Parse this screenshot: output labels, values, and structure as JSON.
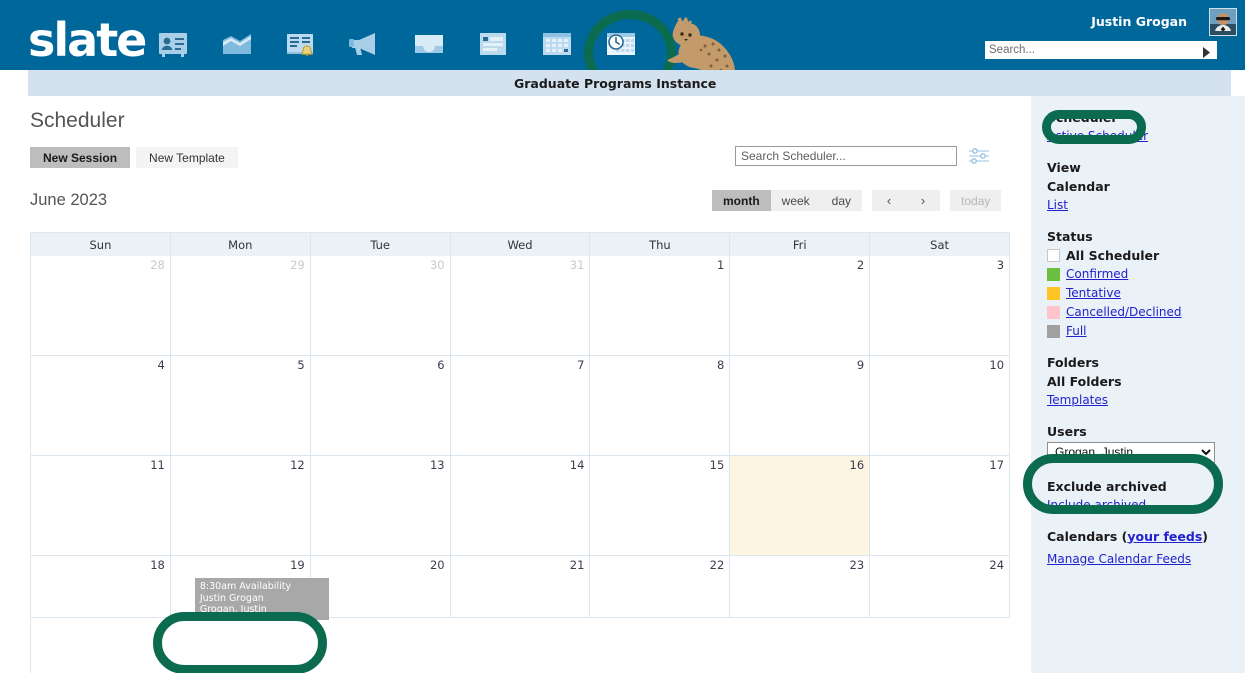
{
  "header": {
    "logo_text": "slate",
    "instance_title": "Graduate Programs Instance",
    "username": "Justin Grogan",
    "search_placeholder": "Search...",
    "search_value": "",
    "nav_icons": [
      {
        "name": "contact-card-icon",
        "label": "Records"
      },
      {
        "name": "analytics-chart-icon",
        "label": "Analytics"
      },
      {
        "name": "document-bell-icon",
        "label": "Reader"
      },
      {
        "name": "megaphone-icon",
        "label": "Deliver"
      },
      {
        "name": "inbox-tray-icon",
        "label": "Inbox"
      },
      {
        "name": "forms-list-icon",
        "label": "Forms"
      },
      {
        "name": "calendar-grid-icon",
        "label": "Calendar"
      },
      {
        "name": "scheduler-clock-calendar-icon",
        "label": "Scheduler"
      }
    ],
    "active_nav_index": 7
  },
  "toolbar": {
    "page_title": "Scheduler",
    "new_session_label": "New Session",
    "new_template_label": "New Template",
    "scheduler_search_placeholder": "Search Scheduler...",
    "scheduler_search_value": "",
    "filter_icon": "filter-sliders-icon"
  },
  "calendar": {
    "month_label": "June 2023",
    "views": [
      "month",
      "week",
      "day"
    ],
    "active_view": "month",
    "prev_label": "‹",
    "next_label": "›",
    "today_label": "today",
    "today_enabled": false,
    "weekdays": [
      "Sun",
      "Mon",
      "Tue",
      "Wed",
      "Thu",
      "Fri",
      "Sat"
    ],
    "today_date": 16,
    "today_bg": "#FCF5E2",
    "weeks": [
      [
        {
          "day": "28",
          "other": true
        },
        {
          "day": "29",
          "other": true
        },
        {
          "day": "30",
          "other": true
        },
        {
          "day": "31",
          "other": true
        },
        {
          "day": "1",
          "other": false
        },
        {
          "day": "2",
          "other": false
        },
        {
          "day": "3",
          "other": false
        }
      ],
      [
        {
          "day": "4",
          "other": false
        },
        {
          "day": "5",
          "other": false
        },
        {
          "day": "6",
          "other": false
        },
        {
          "day": "7",
          "other": false
        },
        {
          "day": "8",
          "other": false
        },
        {
          "day": "9",
          "other": false
        },
        {
          "day": "10",
          "other": false
        }
      ],
      [
        {
          "day": "11",
          "other": false
        },
        {
          "day": "12",
          "other": false
        },
        {
          "day": "13",
          "other": false
        },
        {
          "day": "14",
          "other": false
        },
        {
          "day": "15",
          "other": false
        },
        {
          "day": "16",
          "other": false,
          "today": true
        },
        {
          "day": "17",
          "other": false
        }
      ],
      [
        {
          "day": "18",
          "other": false
        },
        {
          "day": "19",
          "other": false
        },
        {
          "day": "20",
          "other": false
        },
        {
          "day": "21",
          "other": false
        },
        {
          "day": "22",
          "other": false
        },
        {
          "day": "23",
          "other": false
        },
        {
          "day": "24",
          "other": false
        }
      ]
    ],
    "event": {
      "time_title": "8:30am Availability",
      "line2": "Justin Grogan",
      "line3": "Grogan, Justin",
      "bg": "#A8A8A8"
    }
  },
  "sidebar": {
    "scheduler_group": {
      "current": "Scheduler",
      "link": "Active Scheduler"
    },
    "view_group": {
      "head": "View",
      "current": "Calendar",
      "link": "List"
    },
    "status_group": {
      "head": "Status",
      "items": [
        {
          "label": "All Scheduler",
          "color": "#FFFFFF",
          "current": true
        },
        {
          "label": "Confirmed",
          "color": "#6BBF3F",
          "current": false
        },
        {
          "label": "Tentative",
          "color": "#FFC425",
          "current": false
        },
        {
          "label": "Cancelled/Declined",
          "color": "#FFC4CC",
          "current": false
        },
        {
          "label": "Full",
          "color": "#A0A0A0",
          "current": false
        }
      ]
    },
    "folders_group": {
      "head": "Folders",
      "current": "All Folders",
      "link": "Templates"
    },
    "users_group": {
      "head": "Users",
      "selected": "Grogan, Justin",
      "options": [
        "Grogan, Justin"
      ]
    },
    "archive_group": {
      "current": "Exclude archived",
      "link": "Include archived"
    },
    "calendars_group": {
      "head": "Calendars",
      "feeds_prefix": "(",
      "feeds_link": "your feeds",
      "feeds_suffix": ")",
      "link": "Manage Calendar Feeds"
    }
  },
  "annotations": {
    "ring_color": "#0B6B4F",
    "targets": [
      "scheduler-nav-icon",
      "sidebar-scheduler-label",
      "users-select",
      "calendar-event"
    ]
  }
}
